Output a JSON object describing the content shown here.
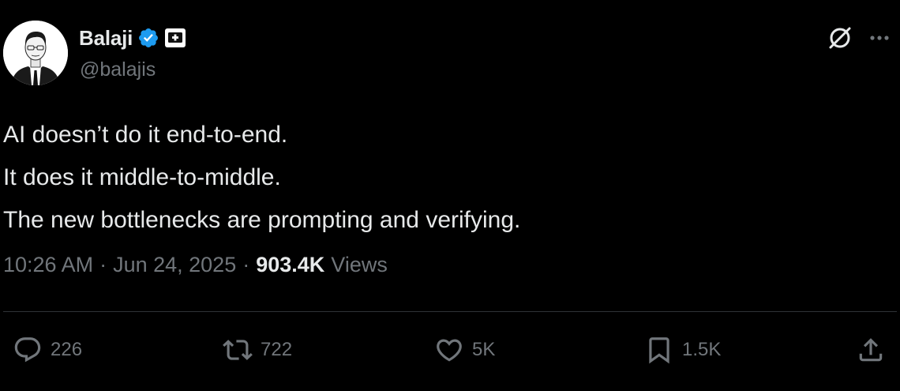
{
  "author": {
    "display_name": "Balaji",
    "handle": "@balajis"
  },
  "tweet": {
    "lines": [
      "AI doesn’t do it end-to-end.",
      "It does it middle-to-middle.",
      "The new bottlenecks are prompting and verifying."
    ]
  },
  "meta": {
    "time": "10:26 AM",
    "separator": "·",
    "date": "Jun 24, 2025",
    "views_count": "903.4K",
    "views_label": "Views"
  },
  "actions": {
    "replies": "226",
    "reposts": "722",
    "likes": "5K",
    "bookmarks": "1.5K"
  },
  "icons": {
    "verified": "verified-badge-icon",
    "affiliate": "affiliate-badge-icon",
    "grok": "grok-icon",
    "more": "more-icon",
    "reply": "reply-icon",
    "repost": "repost-icon",
    "like": "heart-icon",
    "bookmark": "bookmark-icon",
    "share": "share-icon"
  },
  "colors": {
    "background": "#000000",
    "text_primary": "#e7e9ea",
    "text_secondary": "#71767b",
    "verified_blue": "#1d9bf0",
    "divider": "#2f3336"
  }
}
